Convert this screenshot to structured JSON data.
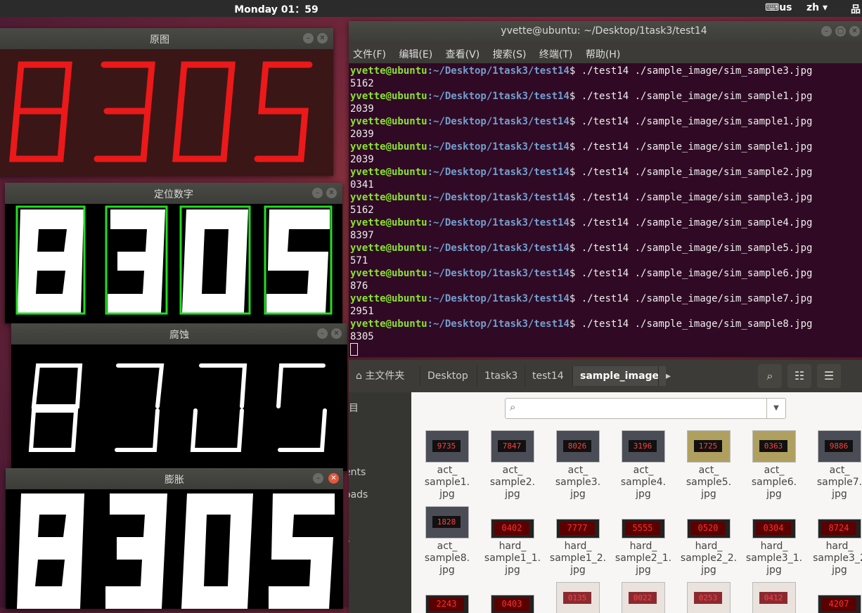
{
  "topbar": {
    "clock": "Monday 01：59",
    "keyboard": "us",
    "language": "zh ▾"
  },
  "windows": {
    "original": {
      "title": "原图",
      "digits": "8305"
    },
    "locate": {
      "title": "定位数字",
      "digits": "8305"
    },
    "erode": {
      "title": "腐蚀",
      "digits": "8305"
    },
    "dilate": {
      "title": "膨胀",
      "digits": "8305"
    }
  },
  "terminal": {
    "title": "yvette@ubuntu: ~/Desktop/1task3/test14",
    "menus": [
      "文件(F)",
      "编辑(E)",
      "查看(V)",
      "搜索(S)",
      "终端(T)",
      "帮助(H)"
    ],
    "prompt_user": "yvette@ubuntu",
    "prompt_path": ":~/Desktop/1task3/test14",
    "prompt_symbol": "$",
    "runs": [
      {
        "command": "./test14 ./sample_image/sim_sample3.jpg",
        "output": "5162"
      },
      {
        "command": "./test14 ./sample_image/sim_sample1.jpg",
        "output": "2039"
      },
      {
        "command": "./test14 ./sample_image/sim_sample1.jpg",
        "output": "2039"
      },
      {
        "command": "./test14 ./sample_image/sim_sample1.jpg",
        "output": "2039"
      },
      {
        "command": "./test14 ./sample_image/sim_sample2.jpg",
        "output": "0341"
      },
      {
        "command": "./test14 ./sample_image/sim_sample3.jpg",
        "output": "5162"
      },
      {
        "command": "./test14 ./sample_image/sim_sample4.jpg",
        "output": "8397"
      },
      {
        "command": "./test14 ./sample_image/sim_sample5.jpg",
        "output": "571"
      },
      {
        "command": "./test14 ./sample_image/sim_sample6.jpg",
        "output": "876"
      },
      {
        "command": "./test14 ./sample_image/sim_sample7.jpg",
        "output": "2951"
      },
      {
        "command": "./test14 ./sample_image/sim_sample8.jpg",
        "output": "8305"
      }
    ]
  },
  "filemanager": {
    "breadcrumbs": [
      "主文件夹",
      "Desktop",
      "1task3",
      "test14",
      "sample_image"
    ],
    "sidebar_partial": [
      "ents",
      "oads",
      "s"
    ],
    "files_row1": [
      {
        "l1": "act_",
        "l2": "sample1.",
        "l3": "jpg",
        "disp": "9735"
      },
      {
        "l1": "act_",
        "l2": "sample2.",
        "l3": "jpg",
        "disp": "7847"
      },
      {
        "l1": "act_",
        "l2": "sample3.",
        "l3": "jpg",
        "disp": "8026"
      },
      {
        "l1": "act_",
        "l2": "sample4.",
        "l3": "jpg",
        "disp": "3196"
      },
      {
        "l1": "act_",
        "l2": "sample5.",
        "l3": "jpg",
        "disp": "1725"
      },
      {
        "l1": "act_",
        "l2": "sample6.",
        "l3": "jpg",
        "disp": "0363"
      },
      {
        "l1": "act_",
        "l2": "sample7.",
        "l3": "jpg",
        "disp": "9886"
      }
    ],
    "files_row2": [
      {
        "l1": "act_",
        "l2": "sample8.",
        "l3": "jpg",
        "disp": "1828"
      },
      {
        "l1": "hard_",
        "l2": "sample1_1.",
        "l3": "jpg",
        "disp": "0402"
      },
      {
        "l1": "hard_",
        "l2": "sample1_2.",
        "l3": "jpg",
        "disp": "7777"
      },
      {
        "l1": "hard_",
        "l2": "sample2_1.",
        "l3": "jpg",
        "disp": "5555"
      },
      {
        "l1": "hard_",
        "l2": "sample2_2.",
        "l3": "jpg",
        "disp": "0520"
      },
      {
        "l1": "hard_",
        "l2": "sample3_1.",
        "l3": "jpg",
        "disp": "0304"
      },
      {
        "l1": "hard_",
        "l2": "sample3_2",
        "l3": "jpg",
        "disp": "8724"
      }
    ],
    "files_row3": [
      {
        "disp": "2243"
      },
      {
        "disp": "0403"
      },
      {
        "disp": "0135"
      },
      {
        "disp": "0022"
      },
      {
        "disp": "0253"
      },
      {
        "disp": "0412"
      },
      {
        "disp": "4207"
      }
    ]
  }
}
